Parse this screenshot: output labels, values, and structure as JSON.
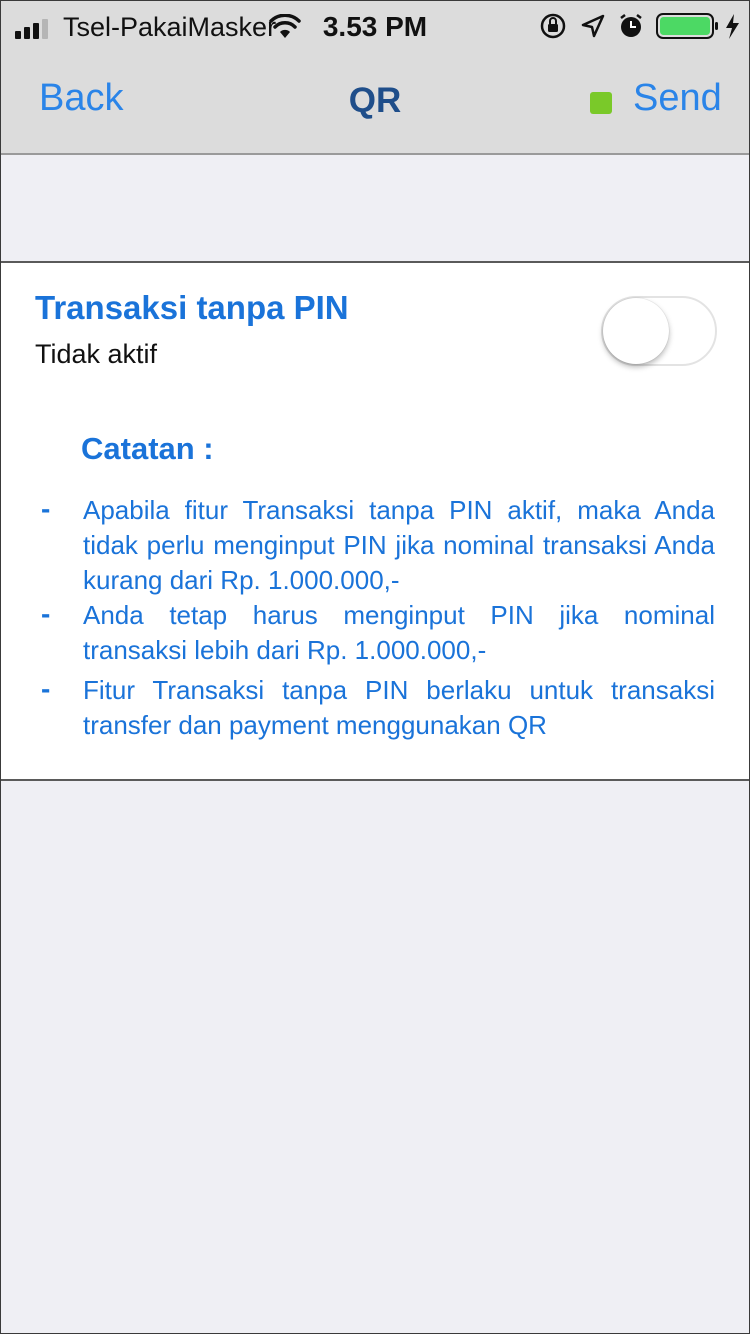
{
  "status_bar": {
    "carrier": "Tsel-PakaiMasker",
    "time": "3.53 PM",
    "battery_color": "#4cd964"
  },
  "nav": {
    "back_label": "Back",
    "title": "QR",
    "send_label": "Send",
    "indicator_color": "#7ac929"
  },
  "setting": {
    "title": "Transaksi tanpa PIN",
    "status": "Tidak aktif",
    "enabled": false
  },
  "notes": {
    "title": "Catatan :",
    "items": [
      {
        "bullet": "-",
        "text": "Apabila fitur Transaksi tanpa PIN aktif, maka Anda tidak perlu menginput PIN jika nominal transaksi Anda kurang  dari Rp. 1.000.000,-"
      },
      {
        "bullet": "-",
        "text": "Anda tetap harus menginput PIN jika nominal transaksi lebih dari Rp. 1.000.000,-"
      },
      {
        "bullet": "-",
        "text": "Fitur Transaksi tanpa PIN berlaku untuk transaksi transfer dan payment menggunakan QR"
      }
    ]
  },
  "colors": {
    "accent": "#2a84e8",
    "text_blue": "#1a73d9",
    "title_navy": "#1f4e8a",
    "background": "#efeff4"
  }
}
